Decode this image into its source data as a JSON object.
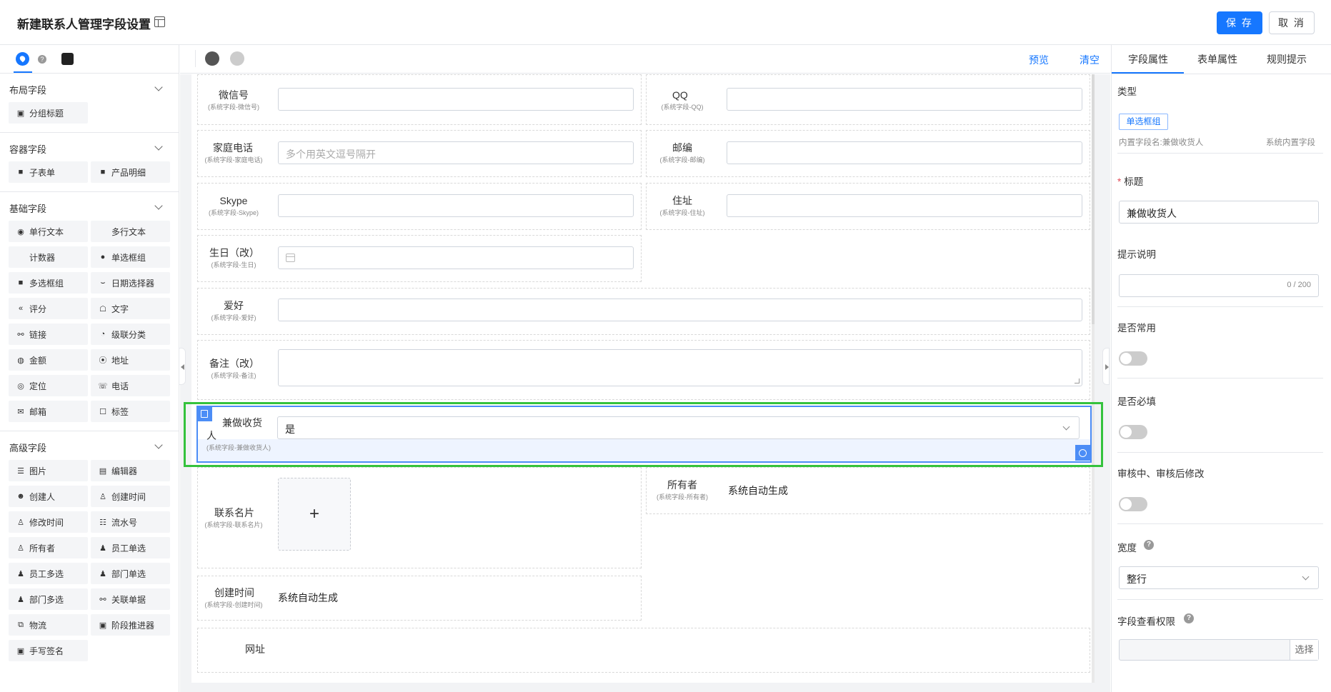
{
  "header": {
    "title": "新建联系人管理字段设置",
    "save_label": "保 存",
    "cancel_label": "取 消"
  },
  "left": {
    "sections": [
      {
        "title": "布局字段",
        "items": [
          {
            "label": "分组标题",
            "icon": "title-icon"
          }
        ]
      },
      {
        "title": "容器字段",
        "items": [
          {
            "label": "子表单",
            "icon": "subform-icon"
          },
          {
            "label": "产品明细",
            "icon": "product-icon"
          }
        ]
      },
      {
        "title": "基础字段",
        "items": [
          {
            "label": "单行文本",
            "icon": "text-icon"
          },
          {
            "label": "多行文本",
            "icon": ""
          },
          {
            "label": "计数器",
            "icon": ""
          },
          {
            "label": "单选框组",
            "icon": "radio-icon"
          },
          {
            "label": "多选框组",
            "icon": "checkbox-icon"
          },
          {
            "label": "日期选择器",
            "icon": "date-icon"
          },
          {
            "label": "评分",
            "icon": "rate-icon"
          },
          {
            "label": "文字",
            "icon": "text-block-icon"
          },
          {
            "label": "链接",
            "icon": "link-icon"
          },
          {
            "label": "级联分类",
            "icon": "cascade-icon"
          },
          {
            "label": "金额",
            "icon": "money-icon"
          },
          {
            "label": "地址",
            "icon": "address-icon"
          },
          {
            "label": "定位",
            "icon": "location-icon"
          },
          {
            "label": "电话",
            "icon": "phone-icon"
          },
          {
            "label": "邮箱",
            "icon": "mail-icon"
          },
          {
            "label": "标签",
            "icon": "tag-icon"
          }
        ]
      },
      {
        "title": "高级字段",
        "items": [
          {
            "label": "图片",
            "icon": "image-icon"
          },
          {
            "label": "编辑器",
            "icon": "editor-icon"
          },
          {
            "label": "创建人",
            "icon": "creator-icon"
          },
          {
            "label": "创建时间",
            "icon": "created-time-icon"
          },
          {
            "label": "修改时间",
            "icon": "modified-time-icon"
          },
          {
            "label": "流水号",
            "icon": "serial-icon"
          },
          {
            "label": "所有者",
            "icon": "owner-icon"
          },
          {
            "label": "员工单选",
            "icon": "staff-single-icon"
          },
          {
            "label": "员工多选",
            "icon": "staff-multi-icon"
          },
          {
            "label": "部门单选",
            "icon": "dept-single-icon"
          },
          {
            "label": "部门多选",
            "icon": "dept-multi-icon"
          },
          {
            "label": "关联单据",
            "icon": "relation-icon"
          },
          {
            "label": "物流",
            "icon": "logistics-icon"
          },
          {
            "label": "阶段推进器",
            "icon": "stage-icon"
          },
          {
            "label": "手写签名",
            "icon": "signature-icon"
          }
        ]
      }
    ]
  },
  "toolbar": {
    "preview": "预览",
    "clear": "清空"
  },
  "form": {
    "wechat": {
      "label": "微信号",
      "sub": "(系统字段-微信号)"
    },
    "qq": {
      "label": "QQ",
      "sub": "(系统字段-QQ)"
    },
    "home_phone": {
      "label": "家庭电话",
      "sub": "(系统字段-家庭电话)",
      "placeholder": "多个用英文逗号隔开"
    },
    "postcode": {
      "label": "邮编",
      "sub": "(系统字段-邮编)"
    },
    "skype": {
      "label": "Skype",
      "sub": "(系统字段-Skype)"
    },
    "residence": {
      "label": "住址",
      "sub": "(系统字段-住址)"
    },
    "birthday": {
      "label": "生日（改）",
      "sub": "(系统字段-生日)"
    },
    "hobby": {
      "label": "爱好",
      "sub": "(系统字段-爱好)"
    },
    "remark": {
      "label": "备注（改）",
      "sub": "(系统字段-备注)"
    },
    "selected": {
      "label_line1": "兼做收货",
      "label_line2": "人",
      "sub": "(系统字段-兼做收货人)",
      "value": "是"
    },
    "card": {
      "label": "联系名片",
      "sub": "(系统字段-联系名片)",
      "plus": "+"
    },
    "owner": {
      "label": "所有者",
      "sub": "(系统字段-所有者)",
      "value": "系统自动生成"
    },
    "created": {
      "label": "创建时间",
      "sub": "(系统字段-创建时间)",
      "value": "系统自动生成"
    },
    "website": {
      "label": "网址"
    }
  },
  "right": {
    "tabs": [
      "字段属性",
      "表单属性",
      "规则提示"
    ],
    "type_label": "类型",
    "type_value": "单选框组",
    "internal_name": "内置字段名:兼做收货人",
    "system_builtin": "系统内置字段",
    "required_mark": "*",
    "title_label": "标题",
    "title_value": "兼做收货人",
    "hint_label": "提示说明",
    "hint_counter": "0 / 200",
    "common_label": "是否常用",
    "must_label": "是否必填",
    "audit_label": "审核中、审核后修改",
    "width_label": "宽度",
    "width_value": "整行",
    "perm_label": "字段查看权限",
    "perm_button": "选择",
    "help_glyph": "?"
  }
}
